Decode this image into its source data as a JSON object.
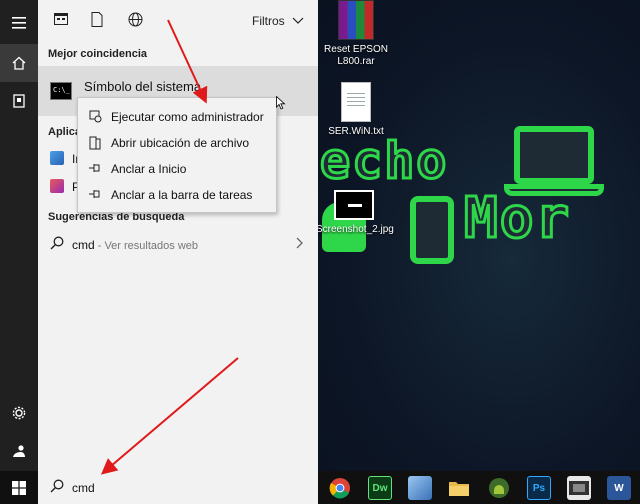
{
  "desktop": {
    "icons": [
      {
        "label": "Reset EPSON L800.rar",
        "line1": "Reset EPSON",
        "line2": "L800.rar"
      },
      {
        "label": "SER.WiN.txt"
      },
      {
        "label": "Screenshot_2.jpg"
      }
    ],
    "brand": {
      "line1": "echo",
      "line2": "Mor"
    },
    "accent": "#2ed64a"
  },
  "sidebar": {
    "icons": [
      "hamburger-icon",
      "home-icon",
      "device-icon",
      "settings-icon",
      "user-icon"
    ]
  },
  "panel": {
    "topbar": {
      "icons": [
        "apps-filter-icon",
        "documents-filter-icon",
        "web-filter-icon"
      ],
      "filters_label": "Filtros"
    },
    "best_match": {
      "section": "Mejor coincidencia",
      "title": "Símbolo del sistema"
    },
    "apps": {
      "section": "Aplica",
      "items": [
        {
          "label": "In",
          "icon": "app-icon"
        },
        {
          "label": "P",
          "icon": "app-icon"
        }
      ]
    },
    "suggestions": {
      "section": "Sugerencias de busqueda",
      "query": "cmd",
      "hint": " - Ver resultados web"
    }
  },
  "context_menu": {
    "items": [
      {
        "label": "Ejecutar como administrador",
        "icon": "shield-icon"
      },
      {
        "label": "Abrir ubicación de archivo",
        "icon": "folder-icon"
      },
      {
        "label": "Anclar a Inicio",
        "icon": "pin-icon"
      },
      {
        "label": "Anclar a la barra de tareas",
        "icon": "pin-icon"
      }
    ]
  },
  "taskbar": {
    "search_value": "cmd",
    "apps": [
      {
        "name": "chrome-icon",
        "text": "",
        "color": "#e8e8e8"
      },
      {
        "name": "dreamweaver-icon",
        "text": "Dw",
        "color": "#0b3b17"
      },
      {
        "name": "package-icon",
        "text": "",
        "color": "#6aa0d8"
      },
      {
        "name": "folder-icon",
        "text": "",
        "color": "#e8b84a"
      },
      {
        "name": "android-icon",
        "text": "",
        "color": "#5a8a3a"
      },
      {
        "name": "photoshop-icon",
        "text": "Ps",
        "color": "#0a2a4a"
      },
      {
        "name": "film-icon",
        "text": "",
        "color": "#444444"
      },
      {
        "name": "word-icon",
        "text": "W",
        "color": "#2b579a"
      }
    ]
  }
}
